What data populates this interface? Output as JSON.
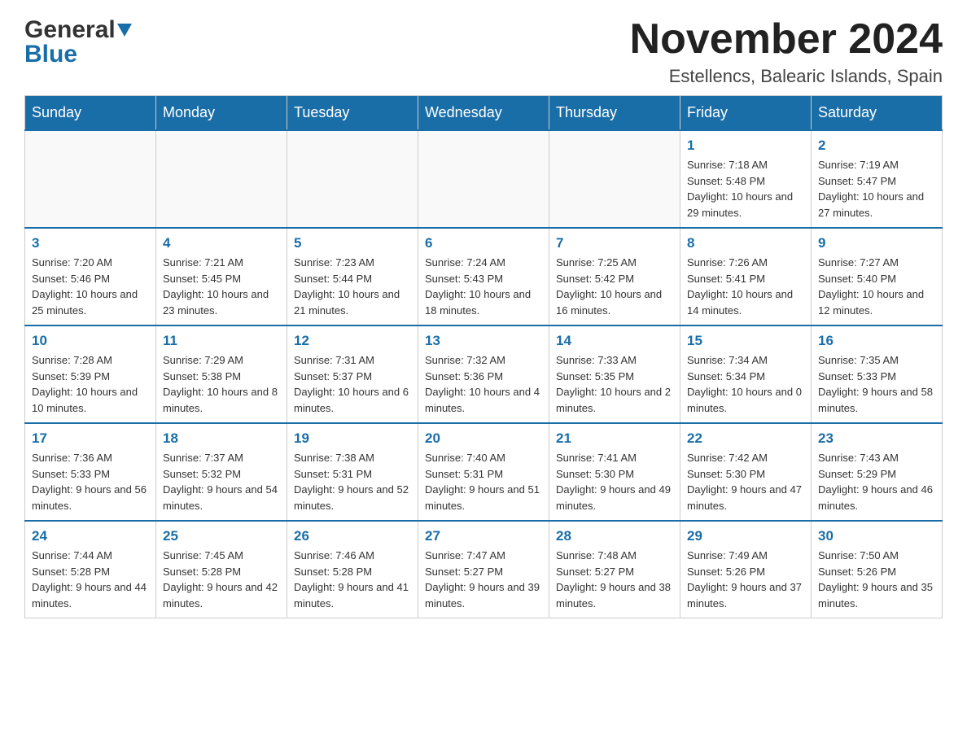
{
  "header": {
    "logo_general": "General",
    "logo_blue": "Blue",
    "month_title": "November 2024",
    "location": "Estellencs, Balearic Islands, Spain"
  },
  "days_of_week": [
    "Sunday",
    "Monday",
    "Tuesday",
    "Wednesday",
    "Thursday",
    "Friday",
    "Saturday"
  ],
  "weeks": [
    [
      {
        "day": "",
        "info": ""
      },
      {
        "day": "",
        "info": ""
      },
      {
        "day": "",
        "info": ""
      },
      {
        "day": "",
        "info": ""
      },
      {
        "day": "",
        "info": ""
      },
      {
        "day": "1",
        "info": "Sunrise: 7:18 AM\nSunset: 5:48 PM\nDaylight: 10 hours and 29 minutes."
      },
      {
        "day": "2",
        "info": "Sunrise: 7:19 AM\nSunset: 5:47 PM\nDaylight: 10 hours and 27 minutes."
      }
    ],
    [
      {
        "day": "3",
        "info": "Sunrise: 7:20 AM\nSunset: 5:46 PM\nDaylight: 10 hours and 25 minutes."
      },
      {
        "day": "4",
        "info": "Sunrise: 7:21 AM\nSunset: 5:45 PM\nDaylight: 10 hours and 23 minutes."
      },
      {
        "day": "5",
        "info": "Sunrise: 7:23 AM\nSunset: 5:44 PM\nDaylight: 10 hours and 21 minutes."
      },
      {
        "day": "6",
        "info": "Sunrise: 7:24 AM\nSunset: 5:43 PM\nDaylight: 10 hours and 18 minutes."
      },
      {
        "day": "7",
        "info": "Sunrise: 7:25 AM\nSunset: 5:42 PM\nDaylight: 10 hours and 16 minutes."
      },
      {
        "day": "8",
        "info": "Sunrise: 7:26 AM\nSunset: 5:41 PM\nDaylight: 10 hours and 14 minutes."
      },
      {
        "day": "9",
        "info": "Sunrise: 7:27 AM\nSunset: 5:40 PM\nDaylight: 10 hours and 12 minutes."
      }
    ],
    [
      {
        "day": "10",
        "info": "Sunrise: 7:28 AM\nSunset: 5:39 PM\nDaylight: 10 hours and 10 minutes."
      },
      {
        "day": "11",
        "info": "Sunrise: 7:29 AM\nSunset: 5:38 PM\nDaylight: 10 hours and 8 minutes."
      },
      {
        "day": "12",
        "info": "Sunrise: 7:31 AM\nSunset: 5:37 PM\nDaylight: 10 hours and 6 minutes."
      },
      {
        "day": "13",
        "info": "Sunrise: 7:32 AM\nSunset: 5:36 PM\nDaylight: 10 hours and 4 minutes."
      },
      {
        "day": "14",
        "info": "Sunrise: 7:33 AM\nSunset: 5:35 PM\nDaylight: 10 hours and 2 minutes."
      },
      {
        "day": "15",
        "info": "Sunrise: 7:34 AM\nSunset: 5:34 PM\nDaylight: 10 hours and 0 minutes."
      },
      {
        "day": "16",
        "info": "Sunrise: 7:35 AM\nSunset: 5:33 PM\nDaylight: 9 hours and 58 minutes."
      }
    ],
    [
      {
        "day": "17",
        "info": "Sunrise: 7:36 AM\nSunset: 5:33 PM\nDaylight: 9 hours and 56 minutes."
      },
      {
        "day": "18",
        "info": "Sunrise: 7:37 AM\nSunset: 5:32 PM\nDaylight: 9 hours and 54 minutes."
      },
      {
        "day": "19",
        "info": "Sunrise: 7:38 AM\nSunset: 5:31 PM\nDaylight: 9 hours and 52 minutes."
      },
      {
        "day": "20",
        "info": "Sunrise: 7:40 AM\nSunset: 5:31 PM\nDaylight: 9 hours and 51 minutes."
      },
      {
        "day": "21",
        "info": "Sunrise: 7:41 AM\nSunset: 5:30 PM\nDaylight: 9 hours and 49 minutes."
      },
      {
        "day": "22",
        "info": "Sunrise: 7:42 AM\nSunset: 5:30 PM\nDaylight: 9 hours and 47 minutes."
      },
      {
        "day": "23",
        "info": "Sunrise: 7:43 AM\nSunset: 5:29 PM\nDaylight: 9 hours and 46 minutes."
      }
    ],
    [
      {
        "day": "24",
        "info": "Sunrise: 7:44 AM\nSunset: 5:28 PM\nDaylight: 9 hours and 44 minutes."
      },
      {
        "day": "25",
        "info": "Sunrise: 7:45 AM\nSunset: 5:28 PM\nDaylight: 9 hours and 42 minutes."
      },
      {
        "day": "26",
        "info": "Sunrise: 7:46 AM\nSunset: 5:28 PM\nDaylight: 9 hours and 41 minutes."
      },
      {
        "day": "27",
        "info": "Sunrise: 7:47 AM\nSunset: 5:27 PM\nDaylight: 9 hours and 39 minutes."
      },
      {
        "day": "28",
        "info": "Sunrise: 7:48 AM\nSunset: 5:27 PM\nDaylight: 9 hours and 38 minutes."
      },
      {
        "day": "29",
        "info": "Sunrise: 7:49 AM\nSunset: 5:26 PM\nDaylight: 9 hours and 37 minutes."
      },
      {
        "day": "30",
        "info": "Sunrise: 7:50 AM\nSunset: 5:26 PM\nDaylight: 9 hours and 35 minutes."
      }
    ]
  ]
}
